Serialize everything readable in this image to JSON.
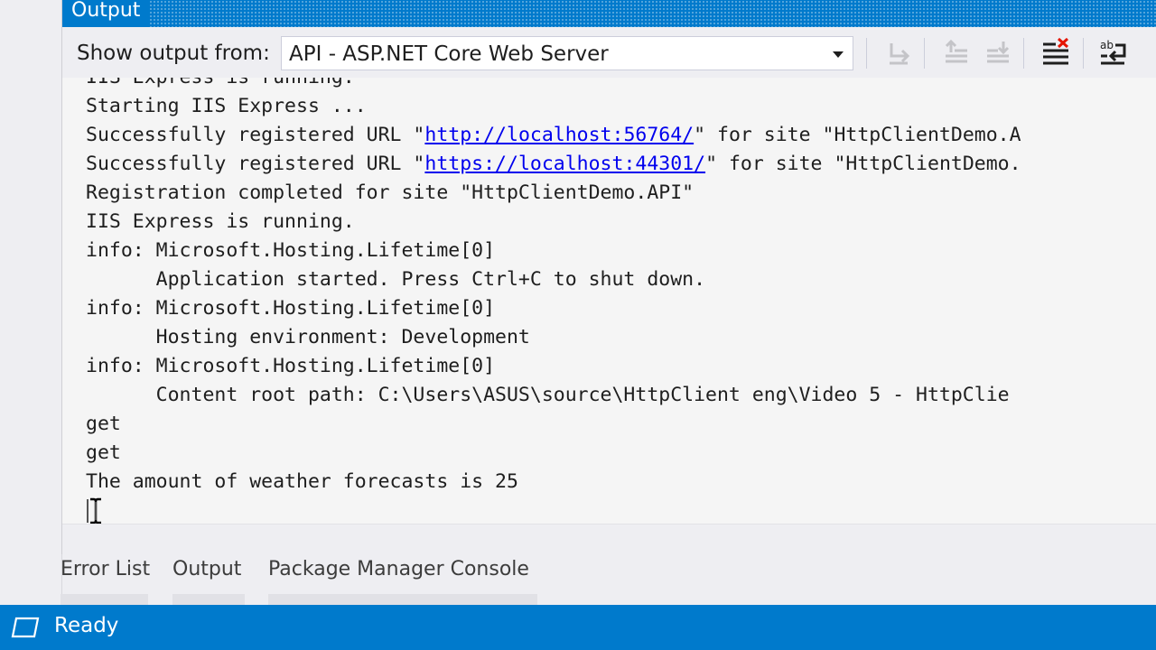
{
  "panel": {
    "title": "Output",
    "toolbar": {
      "show_output_label": "Show output from:",
      "source_selected": "API - ASP.NET Core Web Server",
      "buttons": [
        {
          "name": "find-message-in-code-icon",
          "enabled": false
        },
        {
          "name": "go-to-previous-message-icon",
          "enabled": false
        },
        {
          "name": "go-to-next-message-icon",
          "enabled": false
        },
        {
          "name": "clear-all-icon",
          "enabled": true
        },
        {
          "name": "toggle-word-wrap-icon",
          "enabled": true
        }
      ]
    },
    "lines": [
      {
        "text": "IIS Express is running."
      },
      {
        "text": "Starting IIS Express ..."
      },
      {
        "before": "Successfully registered URL \"",
        "link": "http://localhost:56764/",
        "after": "\" for site \"HttpClientDemo.A"
      },
      {
        "before": "Successfully registered URL \"",
        "link": "https://localhost:44301/",
        "after": "\" for site \"HttpClientDemo."
      },
      {
        "text": "Registration completed for site \"HttpClientDemo.API\""
      },
      {
        "text": "IIS Express is running."
      },
      {
        "text": "info: Microsoft.Hosting.Lifetime[0]"
      },
      {
        "text": "      Application started. Press Ctrl+C to shut down."
      },
      {
        "text": "info: Microsoft.Hosting.Lifetime[0]"
      },
      {
        "text": "      Hosting environment: Development"
      },
      {
        "text": "info: Microsoft.Hosting.Lifetime[0]"
      },
      {
        "text": "      Content root path: C:\\Users\\ASUS\\source\\HttpClient eng\\Video 5 - HttpClie"
      },
      {
        "text": "get"
      },
      {
        "text": "get"
      },
      {
        "text": "The amount of weather forecasts is 25"
      }
    ]
  },
  "tabs": [
    "Error List",
    "Output",
    "Package Manager Console"
  ],
  "status": {
    "text": "Ready"
  },
  "colors": {
    "accent": "#007acc",
    "link": "#0000ee",
    "clear_icon_red": "#e51400"
  }
}
